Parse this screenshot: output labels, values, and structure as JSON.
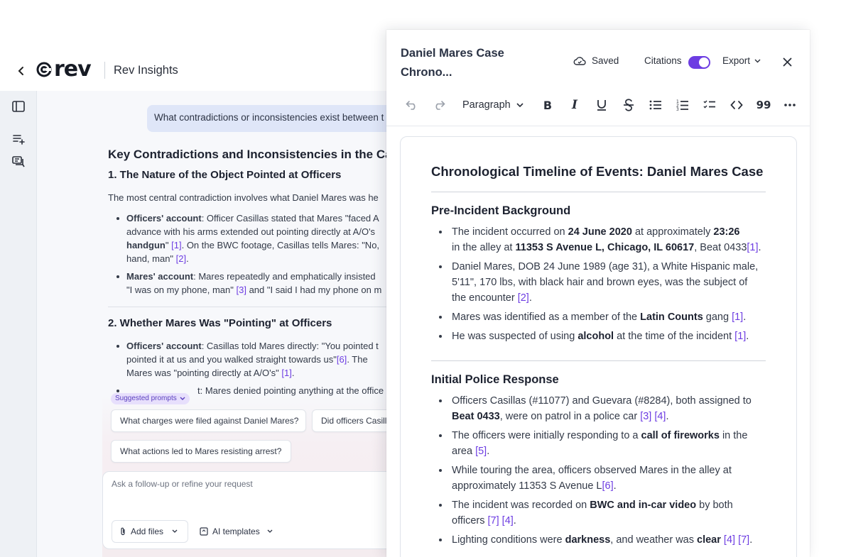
{
  "app": {
    "title": "Rev Insights",
    "logo_text": "rev"
  },
  "chat": {
    "user_message": "What contradictions or inconsistencies exist between t",
    "answer_title": "Key Contradictions and Inconsistencies in the Case",
    "section1": {
      "heading": "1. The Nature of the Object Pointed at Officers",
      "intro": "The most central contradiction involves what Daniel Mares was he",
      "item1": {
        "label": "Officers' account",
        "l1": ": Officer Casillas stated that Mares \"faced A",
        "l2": "advance with his arms extended out pointing directly at A/O's",
        "l3_bold": "handgun",
        "l3": "\" ",
        "cite_a": "[1]",
        "l3b": ". On the BWC footage, Casillas tells Mares: \"No,",
        "l4": "hand, man\" ",
        "cite_b": "[2]",
        "l4b": "."
      },
      "item2": {
        "label": "Mares' account",
        "l1": ": Mares repeatedly and emphatically insisted",
        "l2": "\"I was on my phone, man\" ",
        "cite_a": "[3]",
        "l2b": " and \"I said I had my phone on m"
      }
    },
    "section2": {
      "heading": "2. Whether Mares Was \"Pointing\" at Officers",
      "item1": {
        "label": "Officers' account",
        "l1": ": Casillas told Mares directly: \"You pointed t",
        "l2": "pointed it at us and you walked straight towards us\"",
        "cite_a": "[6]",
        "l2b": ". The",
        "l3": "Mares was \"pointing directly at A/O's\" ",
        "cite_b": "[1]",
        "l3b": "."
      },
      "item2_partial": "t: Mares denied pointing anything at the office"
    },
    "suggested_label": "Suggested prompts",
    "suggestions": [
      "What charges were filed against Daniel Mares?",
      "Did officers Casill",
      "What actions led to Mares resisting arrest?"
    ],
    "composer_placeholder": "Ask a follow-up or refine your request",
    "add_files": "Add files",
    "ai_templates": "AI templates"
  },
  "panel": {
    "title": "Daniel Mares Case Chrono...",
    "saved": "Saved",
    "citations_label": "Citations",
    "citations_on": true,
    "export": "Export",
    "paragraph_style": "Paragraph",
    "accent": "#6d3de2",
    "doc": {
      "title": "Chronological Timeline of Events: Daniel Mares Case",
      "s1_heading": "Pre-Incident Background",
      "s1": {
        "b1": {
          "t1": "The incident occurred on ",
          "b_a": "24 June 2020",
          "t2": " at approximately ",
          "b_b": "23:26",
          "t3": "in the alley at ",
          "b_c": "11353 S Avenue L, Chicago, IL 60617",
          "t4": ", Beat 0433",
          "cite": "[1]",
          "t5": "."
        },
        "b2": {
          "l1": "Daniel Mares, DOB 24 June 1989 (age 31), a White Hispanic male,",
          "l2": "5'11\", 170 lbs, with black hair and brown eyes, was the subject of",
          "l3": "the encounter ",
          "cite": "[2]",
          "l3b": "."
        },
        "b3": {
          "t1": "Mares was identified as a member of the ",
          "b_a": "Latin Counts",
          "t2": " gang ",
          "cite": "[1]",
          "t3": "."
        },
        "b4": {
          "t1": "He was suspected of using ",
          "b_a": "alcohol",
          "t2": " at the time of the incident ",
          "cite": "[1]",
          "t3": "."
        }
      },
      "s2_heading": "Initial Police Response",
      "s2": {
        "b1": {
          "l1": "Officers Casillas (#11077) and Guevara (#8284), both assigned to",
          "b_a": "Beat 0433",
          "t2": ", were on patrol in a police car ",
          "cite_a": "[3]",
          "cite_b": "[4]",
          "t3": "."
        },
        "b2": {
          "t1": "The officers were initially responding to a ",
          "b_a": "call of fireworks",
          "t2": " in the",
          "l2": "area ",
          "cite": "[5]",
          "l2b": "."
        },
        "b3": {
          "l1": "While touring the area, officers observed Mares in the alley at",
          "l2": "approximately 11353 S Avenue L",
          "cite": "[6]",
          "l2b": "."
        },
        "b4": {
          "t1": "The incident was recorded on ",
          "b_a": "BWC and in-car video",
          "t2": " by both",
          "l2": "officers ",
          "cite_a": "[7]",
          "cite_b": "[4]",
          "l2b": "."
        },
        "b5": {
          "t1": "Lighting conditions were ",
          "b_a": "darkness",
          "t2": ", and weather was ",
          "b_b": "clear",
          "cite_a": "[4]",
          "cite_b": "[7]",
          "t3": "."
        }
      }
    }
  }
}
